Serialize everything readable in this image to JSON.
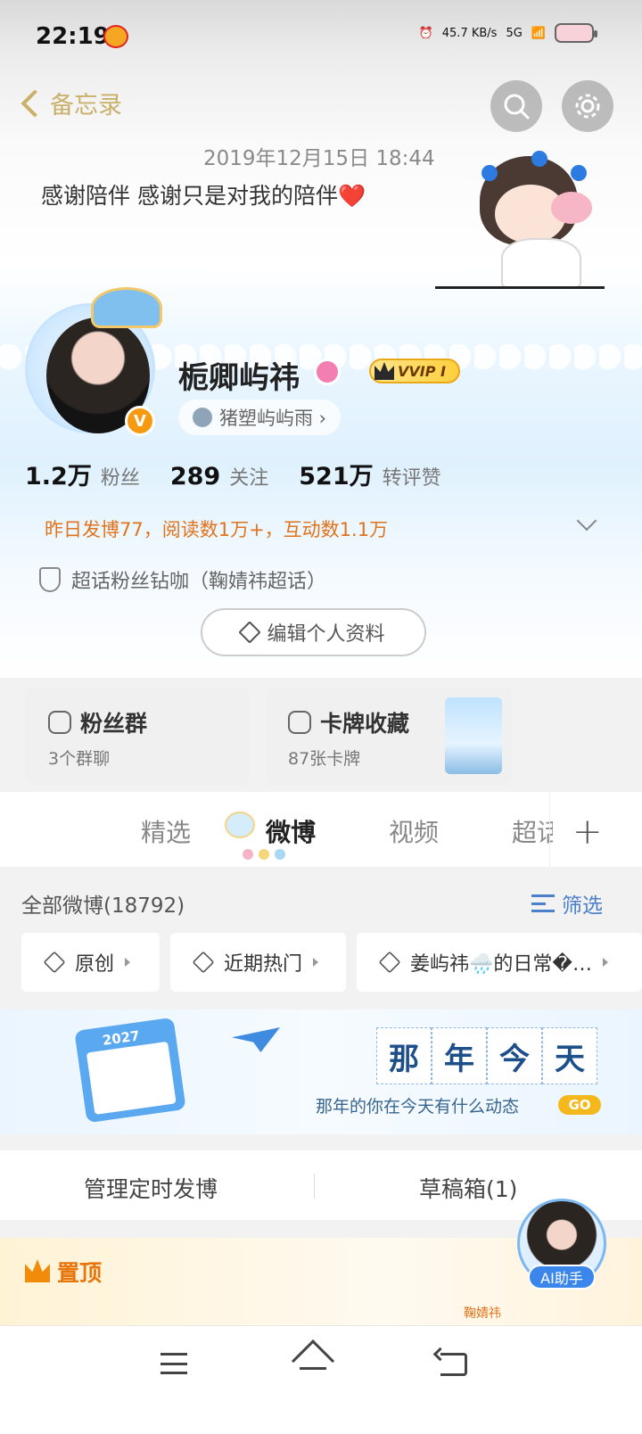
{
  "status_bar": {
    "time": "22:19",
    "network_speed": "45.7 KB/s",
    "network_type": "5G"
  },
  "header": {
    "back_label": "备忘录"
  },
  "memo": {
    "date": "2019年12月15日 18:44",
    "text": "感谢陪伴 感谢只是对我的陪伴",
    "emoji": "❤️"
  },
  "profile": {
    "username": "栀卿屿祎",
    "vip_badge": "VVIP Ⅰ",
    "verified_badge": "V",
    "group_link": "猪塑屿屿雨 ›",
    "stats": [
      {
        "num": "1.2万",
        "label": "粉丝"
      },
      {
        "num": "289",
        "label": "关注"
      },
      {
        "num": "521万",
        "label": "转评赞"
      }
    ],
    "activity": "昨日发博77，阅读数1万+，互动数1.1万",
    "super_fan": "超话粉丝钻咖（鞠婧祎超话）",
    "edit_button": "编辑个人资料"
  },
  "cards": {
    "fans_group": {
      "title": "粉丝群",
      "sub": "3个群聊"
    },
    "card_collection": {
      "title": "卡牌收藏",
      "sub": "87张卡牌"
    }
  },
  "tabs": [
    "精选",
    "微博",
    "视频",
    "超话"
  ],
  "tabs_active_index": 1,
  "feed": {
    "all_count": "全部微博(18792)",
    "filter_label": "筛选",
    "chips": [
      "原创",
      "近期热门",
      "姜屿祎🌧️的日常�…"
    ]
  },
  "banner": {
    "calendar_year": "2027",
    "title_chars": [
      "那",
      "年",
      "今",
      "天"
    ],
    "subtitle": "那年的你在今天有什么动态",
    "go_label": "GO"
  },
  "manage": {
    "scheduled": "管理定时发博",
    "drafts": "草稿箱(1)"
  },
  "pinned": {
    "label": "置顶",
    "tag": "鞠婧祎"
  },
  "ai_assistant": {
    "label": "AI助手"
  },
  "colors": {
    "accent_orange": "#e0731c",
    "link_blue": "#4a7fc9",
    "weibo_red": "#e0261f"
  }
}
